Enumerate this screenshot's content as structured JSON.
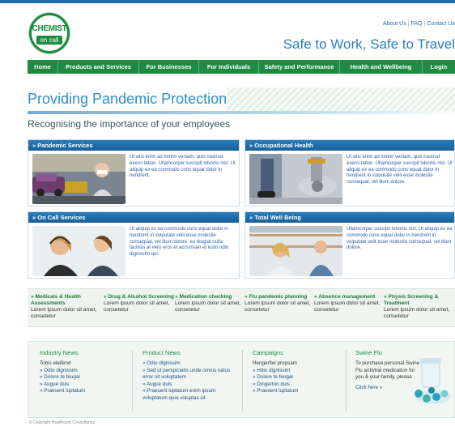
{
  "header": {
    "logo_line1": "CHEMIST",
    "logo_line2": "on call",
    "links": [
      "About Us",
      "FAQ",
      "Contact Us"
    ],
    "tagline": "Safe to Work, Safe to Travel"
  },
  "nav": [
    "Home",
    "Products and Services",
    "For Businesses",
    "For Individuals",
    "Safety and Performance",
    "Health and Wellbeing",
    "Login"
  ],
  "hero": {
    "title": "Providing Pandemic Protection",
    "subtitle": "Recognising the importance of your employees"
  },
  "panels": [
    {
      "title": "» Pandemic Services",
      "text": "Ut wisi enim ad minim veniam, quis nostrud exerci tation. Ullamcorper suscipit lobortis nisl. Ut aliquip ex ea commodo cons equat dolor in hendrerit."
    },
    {
      "title": "» Occupational Health",
      "text": "Ut wisi enim ad minim veniam, quis nostrud exerci tation. Ullamcorper suscipit lobortis nisl. Ut aliquip ex ea commodo cons equat dolor in hendrerit in vulputate velit esse molestie consequat, vel illum dolore."
    },
    {
      "title": "» On Call Services",
      "text": "Ut aliquip ex ea commodo cons equat dolor in hendrerit in vulputate velit esse molestie consequat, vel illum dolore. eu feugiat nulla facilisis at vero eros et accumsan et iusto odio dignissim qui."
    },
    {
      "title": "» Total Well Being",
      "text": "Ullamcorper suscipit lobortis nisl. Ut aliquip ex ea commodo cons equat dolor in hendrerit in vulputate velit esse molestie consequat, vel illum dolore."
    }
  ],
  "services": [
    {
      "title": "Medicals & Health Assessments",
      "desc": "Lorem ipsum dolor sit amet, consetetur"
    },
    {
      "title": "Drug & Alcohol Screening",
      "desc": "Lorem ipsum dolor sit amet, consetetur"
    },
    {
      "title": "Medication checking",
      "desc": "Lorem ipsum dolor sit amet, consetetur"
    },
    {
      "title": "Flu pandemic planning",
      "desc": "Lorem ipsum dolor sit amet, consetetur"
    },
    {
      "title": "Absence management",
      "desc": "Lorem ipsum dolor sit amet, consetetur"
    },
    {
      "title": "Physio Screening & Treatment",
      "desc": "Lorem ipsum dolor sit amet, consetetur"
    }
  ],
  "news": {
    "industry": {
      "heading": "Industry News",
      "intro": "Tobis eleifend",
      "items": [
        "Odio dignissim",
        "Dolore te feugai",
        "Augue duis",
        "Praesent luptatum"
      ]
    },
    "product": {
      "heading": "Product News",
      "items": [
        "Odio dignissim",
        "Sed ut perspiciatis unde omnis natus error sit voluptatem",
        "Augue duis",
        "Praesent luptatum enim ipsum voluptatum quia voluptas sit"
      ]
    },
    "campaigns": {
      "heading": "Campaigns",
      "intro": "Hengerfiel propsam",
      "items": [
        "Hdio dignissim",
        "Dolore te feugai",
        "Dingerton duis",
        "Praesent luptatum"
      ]
    },
    "swine": {
      "heading": "Swine Flu",
      "text": "To purchase personal Swine Flu antiviral medication for you & your family, please",
      "link": "Click here »"
    }
  },
  "footer": "© Copyright Healthcare Consultancy"
}
